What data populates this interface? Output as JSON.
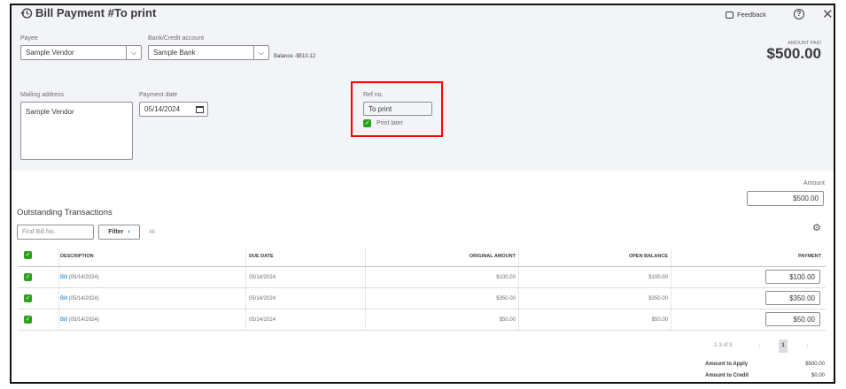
{
  "header": {
    "title": "Bill Payment #To print",
    "feedback": "Feedback",
    "history_icon": "history-icon",
    "help_icon": "help-icon",
    "close_icon": "close-icon"
  },
  "form": {
    "payee_label": "Payee",
    "payee_value": "Sample Vendor",
    "bank_label": "Bank/Credit account",
    "bank_value": "Sample Bank",
    "balance": "Balance -$510.12",
    "amount_paid_label": "AMOUNT PAID",
    "amount_paid": "$500.00",
    "mailing_label": "Mailing address",
    "mailing_value": "Sample Vendor",
    "date_label": "Payment date",
    "date_value": "05/14/2024",
    "ref_label": "Ref no.",
    "ref_value": "To print",
    "print_later": "Print later",
    "amount_label": "Amount",
    "amount_value": "$500.00"
  },
  "transactions": {
    "title": "Outstanding Transactions",
    "search_placeholder": "Find Bill No.",
    "filter": "Filter",
    "filter_value": "All",
    "columns": [
      "DESCRIPTION",
      "DUE DATE",
      "ORIGINAL AMOUNT",
      "OPEN BALANCE",
      "PAYMENT"
    ],
    "rows": [
      {
        "link": "Bill",
        "desc": "(05/14/2024)",
        "due": "05/14/2024",
        "original": "$100.00",
        "open": "$100.00",
        "payment": "$100.00"
      },
      {
        "link": "Bill",
        "desc": "(05/14/2024)",
        "due": "05/14/2024",
        "original": "$350.00",
        "open": "$350.00",
        "payment": "$350.00"
      },
      {
        "link": "Bill",
        "desc": "(05/14/2024)",
        "due": "05/14/2024",
        "original": "$50.00",
        "open": "$50.00",
        "payment": "$50.00"
      }
    ],
    "pagination": {
      "range": "1-3 of 3",
      "page": "1",
      "prev": "‹",
      "next": "›"
    },
    "summary": {
      "apply_label": "Amount to Apply",
      "apply_value": "$500.00",
      "credit_label": "Amount to Credit",
      "credit_value": "$0.00"
    }
  },
  "colors": {
    "accent": "#2ca01c",
    "highlight": "#ff0000",
    "link": "#0077c5"
  }
}
